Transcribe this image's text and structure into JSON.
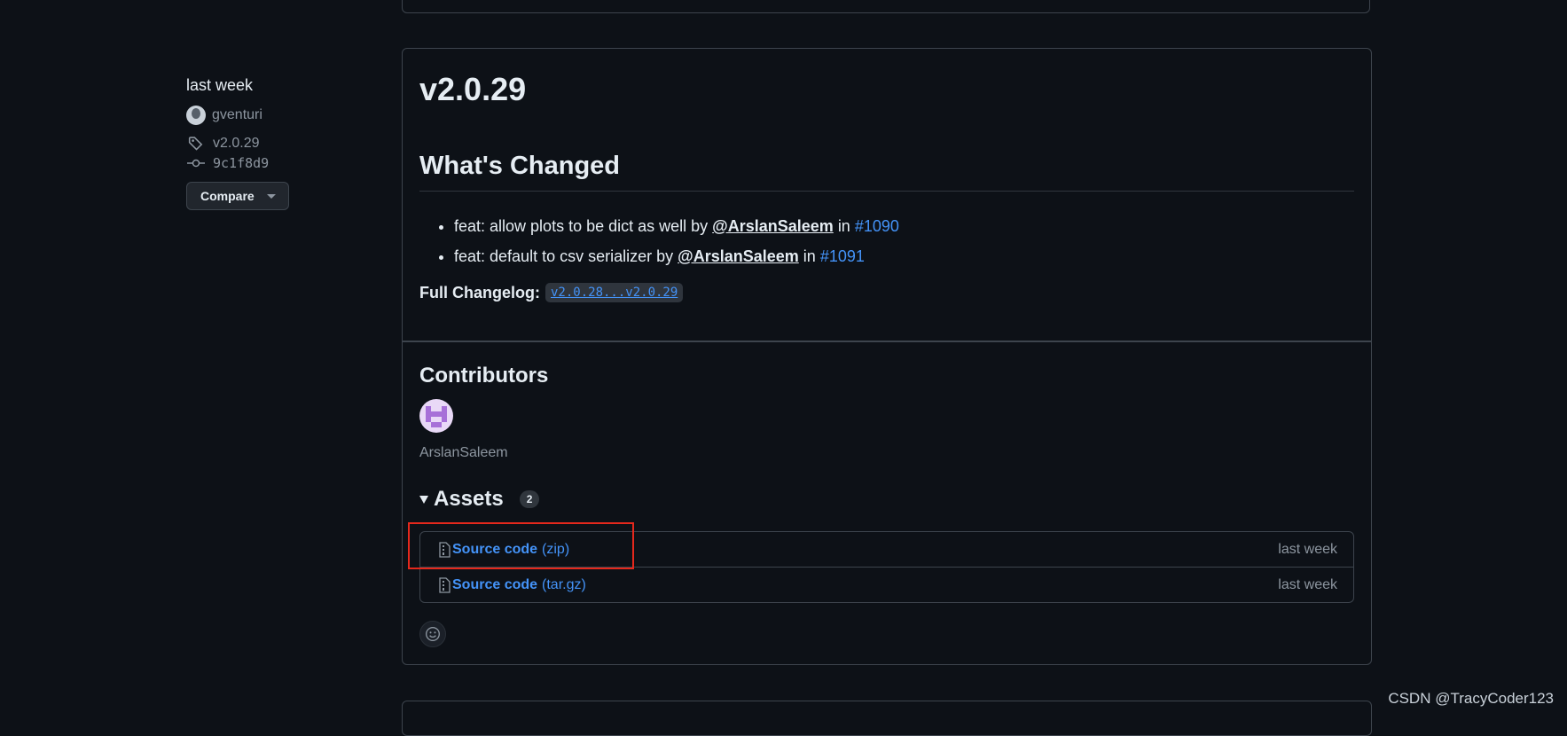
{
  "sidebar": {
    "date": "last week",
    "author": "gventuri",
    "tag": "v2.0.29",
    "commit": "9c1f8d9",
    "compare_label": "Compare"
  },
  "release": {
    "title": "v2.0.29",
    "whats_changed_heading": "What's Changed",
    "changes": [
      {
        "text": "feat: allow plots to be dict as well by",
        "user": "@ArslanSaleem",
        "in": "in",
        "pr": "#1090"
      },
      {
        "text": "feat: default to csv serializer by",
        "user": "@ArslanSaleem",
        "in": "in",
        "pr": "#1091"
      }
    ],
    "full_changelog_label": "Full Changelog",
    "full_changelog_colon": ":",
    "full_changelog_range": "v2.0.28...v2.0.29"
  },
  "contributors": {
    "heading": "Contributors",
    "names": [
      "ArslanSaleem"
    ]
  },
  "assets": {
    "heading": "Assets",
    "count": "2",
    "items": [
      {
        "name": "Source code",
        "format": "(zip)",
        "time": "last week"
      },
      {
        "name": "Source code",
        "format": "(tar.gz)",
        "time": "last week"
      }
    ]
  },
  "watermark": "CSDN @TracyCoder123",
  "colors": {
    "background": "#0d1117",
    "link": "#4493f8",
    "highlight": "#e5281c"
  }
}
